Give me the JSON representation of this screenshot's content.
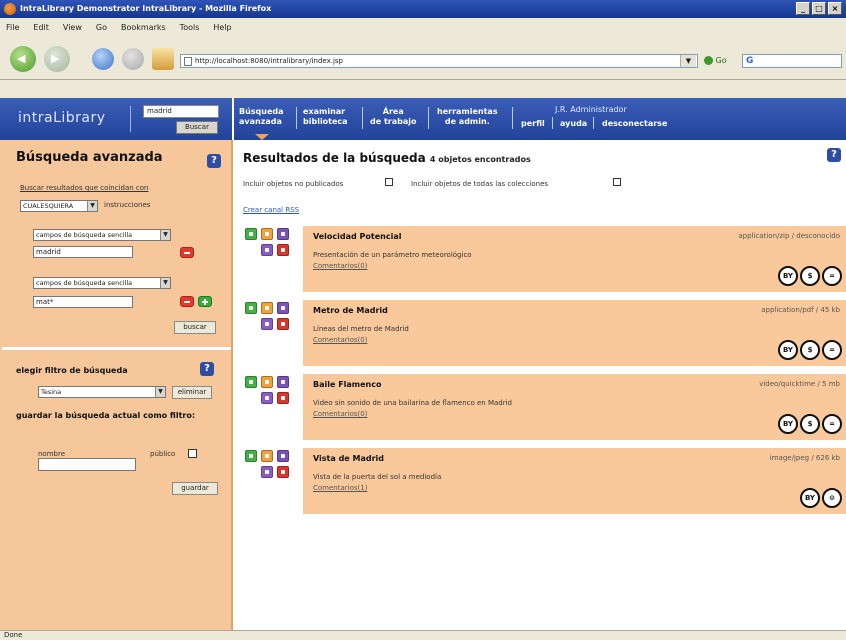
{
  "browser": {
    "title": "IntraLibrary Demonstrator IntraLibrary - Mozilla Firefox",
    "menu": [
      "File",
      "Edit",
      "View",
      "Go",
      "Bookmarks",
      "Tools",
      "Help"
    ],
    "url": "http://localhost:8080/intralibrary/index.jsp",
    "go_label": "Go",
    "search_icon": "G"
  },
  "header": {
    "logo": "intraLibrary",
    "quick_search_value": "madrid",
    "quick_search_button": "Buscar",
    "nav": [
      {
        "line1": "Búsqueda",
        "line2": "avanzada"
      },
      {
        "line1": "examinar",
        "line2": "biblioteca"
      },
      {
        "line1": "Área",
        "line2": "de trabajo"
      },
      {
        "line1": "herramientas",
        "line2": "de admin."
      }
    ],
    "user": "J.R. Administrador",
    "user_links": [
      "perfil",
      "ayuda",
      "desconectarse"
    ]
  },
  "sidebar": {
    "title": "Búsqueda avanzada",
    "filter_hint": "Buscar resultados que coincidan con",
    "match_select": "CUALESQUIERA",
    "match_suffix": "instrucciones",
    "field1_select": "campos de búsqueda sencilla",
    "field1_value": "madrid",
    "field2_select": "campos de búsqueda sencilla",
    "field2_value": "mat*",
    "search_button": "buscar",
    "saved_filter_title": "elegir filtro de búsqueda",
    "saved_select": "Tesina",
    "delete_button": "eliminar",
    "save_title": "guardar la búsqueda actual como filtro:",
    "name_label": "nombre",
    "public_label": "público",
    "save_button": "guardar"
  },
  "main": {
    "title": "Resultados de la búsqueda",
    "count": "4 objetos encontrados",
    "opt_unpublished": "Incluir objetos no publicados",
    "opt_all_collections": "Incluir objetos de todas las colecciones",
    "rss": "Crear canal RSS",
    "results": [
      {
        "title": "Velocidad Potencial",
        "meta": "application/zip / desconocido",
        "desc": "Presentación de un parámetro meteorológico",
        "comments": "Comentarios(0)",
        "licenses": [
          "BY",
          "$",
          "="
        ]
      },
      {
        "title": "Metro de Madrid",
        "meta": "application/pdf / 45 kb",
        "desc": "Líneas del metro de Madrid",
        "comments": "Comentarios(0)",
        "licenses": [
          "BY",
          "$",
          "="
        ]
      },
      {
        "title": "Baile Flamenco",
        "meta": "video/quicktime / 5 mb",
        "desc": "Video sin sonido de una bailarina de flamenco en Madrid",
        "comments": "Comentarios(0)",
        "licenses": [
          "BY",
          "$",
          "="
        ]
      },
      {
        "title": "Vista de Madrid",
        "meta": "image/jpeg / 626 kb",
        "desc": "Vista de la puerta del sol a mediodía",
        "comments": "Comentarios(1)",
        "licenses": [
          "BY",
          "⊙"
        ]
      }
    ]
  },
  "status": "Done"
}
